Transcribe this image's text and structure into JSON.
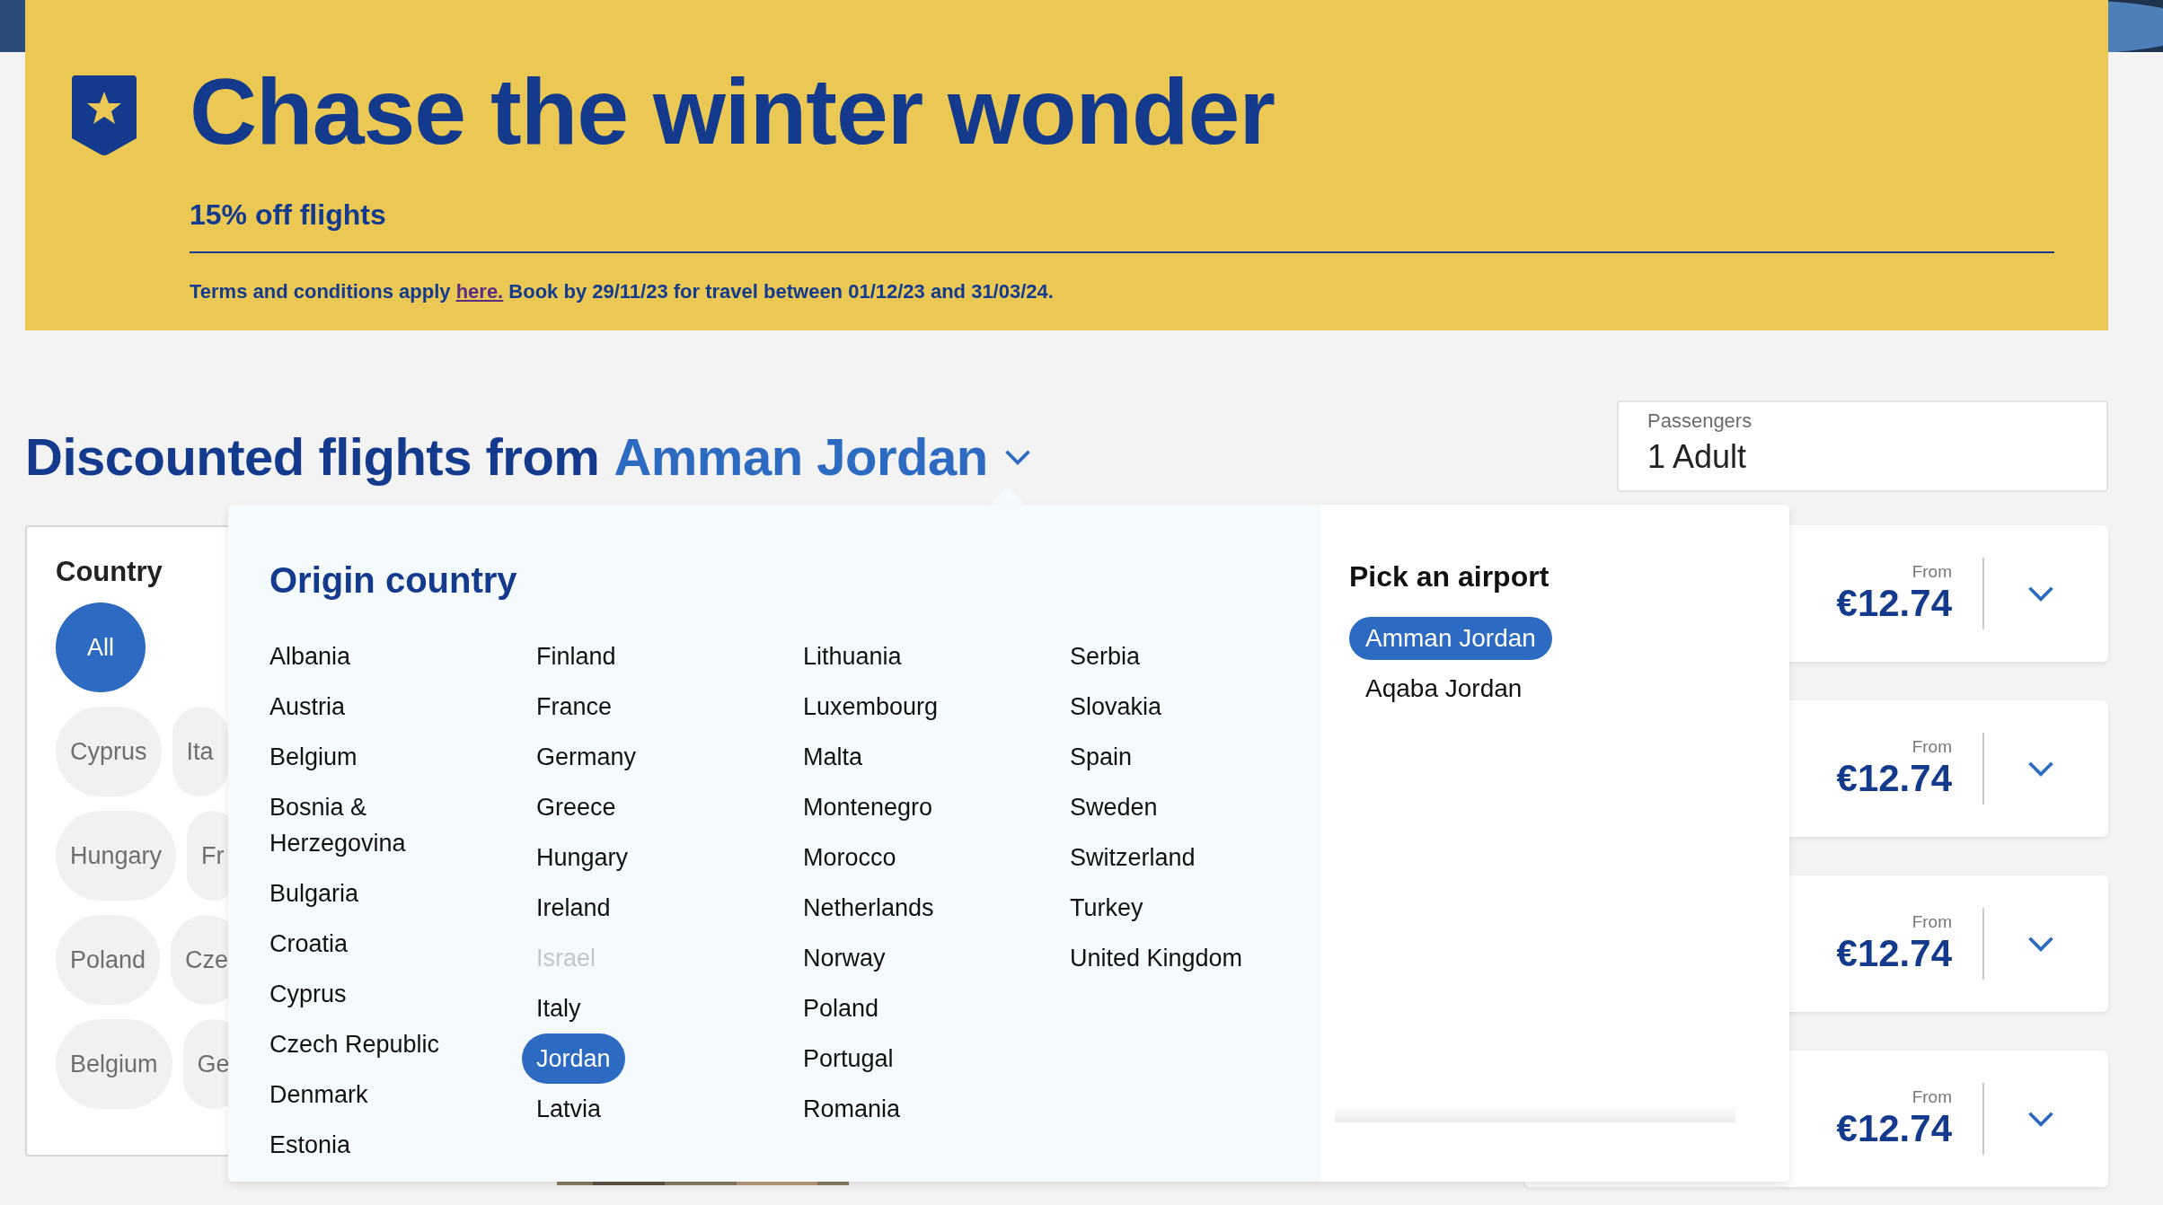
{
  "banner": {
    "title": "Chase the winter wonder",
    "subtitle": "15% off flights",
    "terms": {
      "before": "Terms and conditions apply",
      "link": "here.",
      "after": "Book by 29/11/23 for travel between 01/12/23 and 31/03/24."
    }
  },
  "heading": {
    "text": "Discounted flights from",
    "origin": "Amman Jordan"
  },
  "passengers": {
    "label": "Passengers",
    "value": "1 Adult"
  },
  "country_filter": {
    "title": "Country",
    "rows": [
      [
        {
          "label": "All",
          "selected": true
        }
      ],
      [
        {
          "label": "Cyprus",
          "selected": false
        },
        {
          "label": "Ita",
          "selected": false
        }
      ],
      [
        {
          "label": "Hungary",
          "selected": false
        },
        {
          "label": "Fr",
          "selected": false
        }
      ],
      [
        {
          "label": "Poland",
          "selected": false
        },
        {
          "label": "Cze",
          "selected": false
        }
      ],
      [
        {
          "label": "Belgium",
          "selected": false
        },
        {
          "label": "Ge",
          "selected": false
        }
      ]
    ]
  },
  "origin_dropdown": {
    "title": "Origin country",
    "columns": [
      [
        {
          "name": "Albania",
          "selected": false,
          "disabled": false
        },
        {
          "name": "Austria",
          "selected": false,
          "disabled": false
        },
        {
          "name": "Belgium",
          "selected": false,
          "disabled": false
        },
        {
          "name": "Bosnia & Herzegovina",
          "selected": false,
          "disabled": false
        },
        {
          "name": "Bulgaria",
          "selected": false,
          "disabled": false
        },
        {
          "name": "Croatia",
          "selected": false,
          "disabled": false
        },
        {
          "name": "Cyprus",
          "selected": false,
          "disabled": false
        },
        {
          "name": "Czech Republic",
          "selected": false,
          "disabled": false
        },
        {
          "name": "Denmark",
          "selected": false,
          "disabled": false
        },
        {
          "name": "Estonia",
          "selected": false,
          "disabled": false
        }
      ],
      [
        {
          "name": "Finland",
          "selected": false,
          "disabled": false
        },
        {
          "name": "France",
          "selected": false,
          "disabled": false
        },
        {
          "name": "Germany",
          "selected": false,
          "disabled": false
        },
        {
          "name": "Greece",
          "selected": false,
          "disabled": false
        },
        {
          "name": "Hungary",
          "selected": false,
          "disabled": false
        },
        {
          "name": "Ireland",
          "selected": false,
          "disabled": false
        },
        {
          "name": "Israel",
          "selected": false,
          "disabled": true
        },
        {
          "name": "Italy",
          "selected": false,
          "disabled": false
        },
        {
          "name": "Jordan",
          "selected": true,
          "disabled": false
        },
        {
          "name": "Latvia",
          "selected": false,
          "disabled": false
        }
      ],
      [
        {
          "name": "Lithuania",
          "selected": false,
          "disabled": false
        },
        {
          "name": "Luxembourg",
          "selected": false,
          "disabled": false
        },
        {
          "name": "Malta",
          "selected": false,
          "disabled": false
        },
        {
          "name": "Montenegro",
          "selected": false,
          "disabled": false
        },
        {
          "name": "Morocco",
          "selected": false,
          "disabled": false
        },
        {
          "name": "Netherlands",
          "selected": false,
          "disabled": false
        },
        {
          "name": "Norway",
          "selected": false,
          "disabled": false
        },
        {
          "name": "Poland",
          "selected": false,
          "disabled": false
        },
        {
          "name": "Portugal",
          "selected": false,
          "disabled": false
        },
        {
          "name": "Romania",
          "selected": false,
          "disabled": false
        }
      ],
      [
        {
          "name": "Serbia",
          "selected": false,
          "disabled": false
        },
        {
          "name": "Slovakia",
          "selected": false,
          "disabled": false
        },
        {
          "name": "Spain",
          "selected": false,
          "disabled": false
        },
        {
          "name": "Sweden",
          "selected": false,
          "disabled": false
        },
        {
          "name": "Switzerland",
          "selected": false,
          "disabled": false
        },
        {
          "name": "Turkey",
          "selected": false,
          "disabled": false
        },
        {
          "name": "United Kingdom",
          "selected": false,
          "disabled": false
        }
      ]
    ],
    "airport_title": "Pick an airport",
    "airports": [
      {
        "name": "Amman Jordan",
        "selected": true
      },
      {
        "name": "Aqaba Jordan",
        "selected": false
      }
    ]
  },
  "fares": [
    {
      "label": "From",
      "price": "€12.74"
    },
    {
      "label": "From",
      "price": "€12.74"
    },
    {
      "label": "From",
      "price": "€12.74"
    },
    {
      "label": "From",
      "price": "€12.74"
    }
  ]
}
